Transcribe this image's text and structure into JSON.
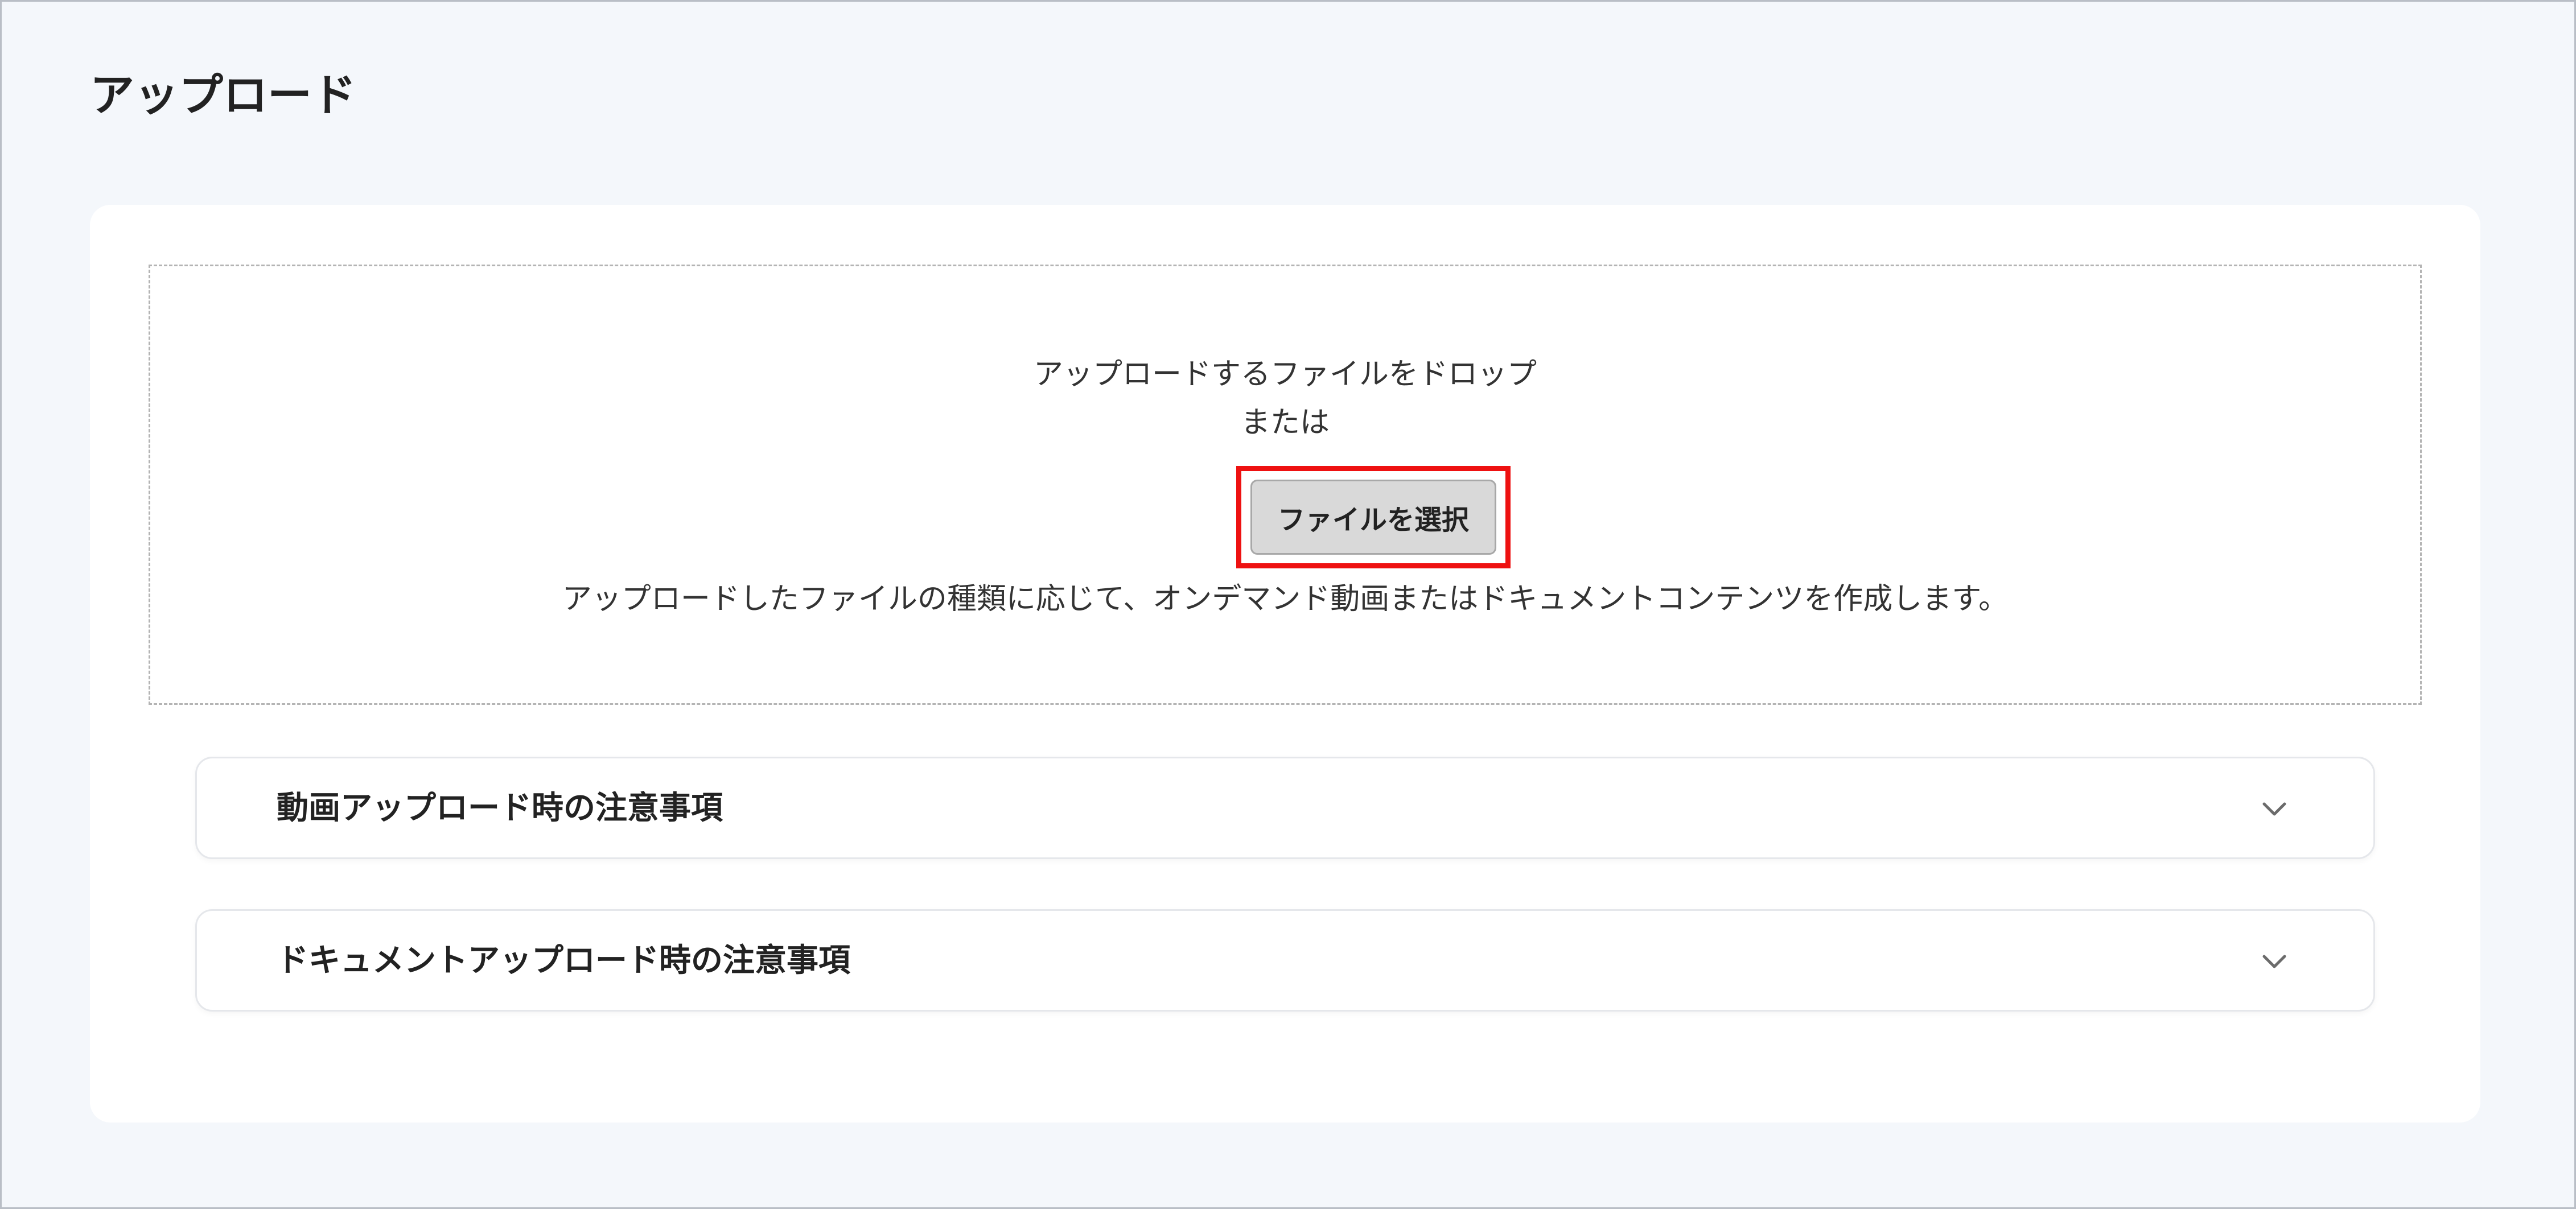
{
  "header": {
    "title": "アップロード"
  },
  "upload": {
    "drop_text": "アップロードするファイルをドロップ",
    "or_text": "または",
    "select_button_label": "ファイルを選択",
    "description": "アップロードしたファイルの種類に応じて、オンデマンド動画またはドキュメントコンテンツを作成します。"
  },
  "notices": [
    {
      "label": "動画アップロード時の注意事項",
      "icon": "chevron-down-icon"
    },
    {
      "label": "ドキュメントアップロード時の注意事項",
      "icon": "chevron-down-icon"
    }
  ],
  "colors": {
    "background": "#f4f7fb",
    "card": "#ffffff",
    "highlight": "#ee1111",
    "button": "#d9d9d9"
  }
}
